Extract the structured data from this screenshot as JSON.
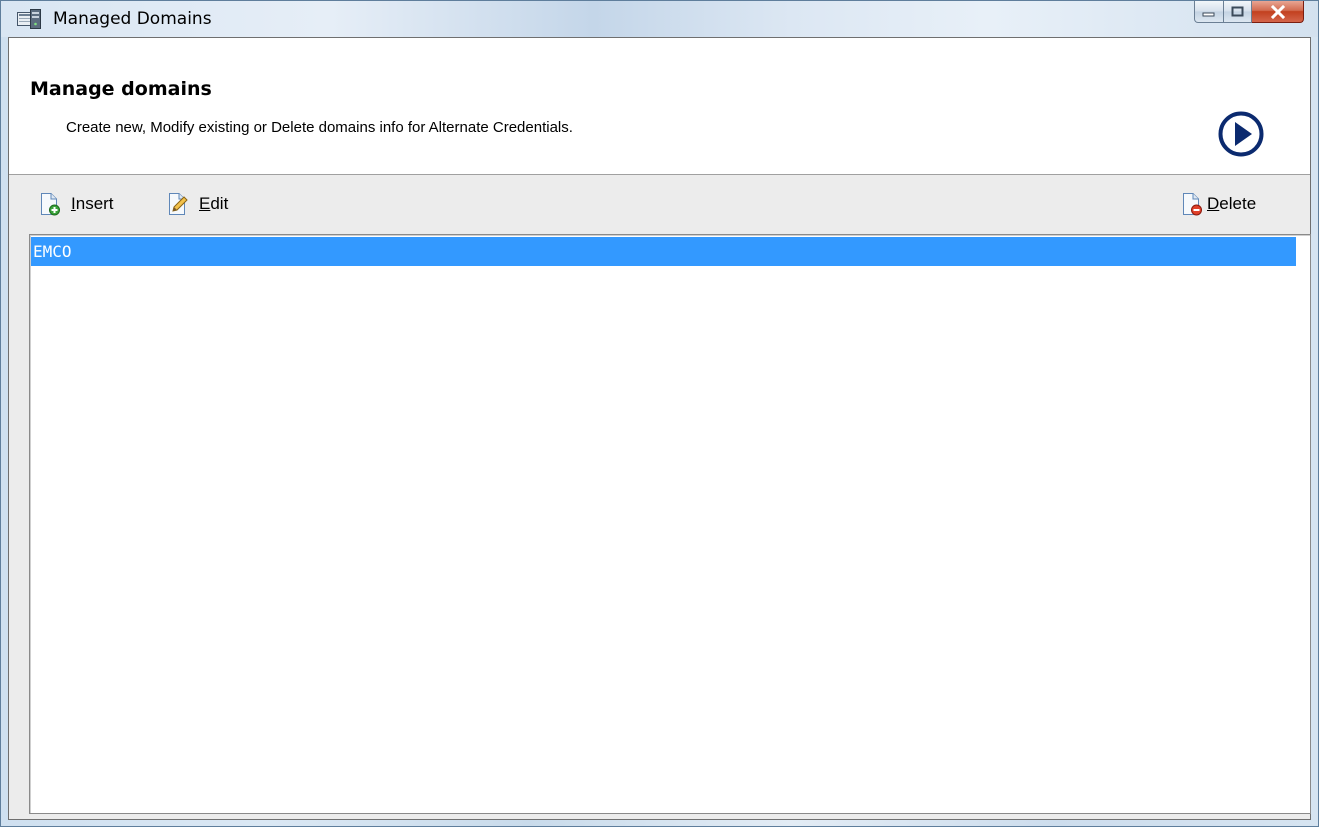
{
  "window": {
    "title": "Managed Domains",
    "icons": {
      "app": "domains-app-icon",
      "minimize": "minimize-icon",
      "maximize": "maximize-icon",
      "close": "close-icon"
    }
  },
  "header": {
    "title": "Manage domains",
    "description": "Create new, Modify existing or Delete domains info for Alternate Credentials.",
    "icon": "play-arrow-icon"
  },
  "toolbar": {
    "insert": {
      "accel": "I",
      "rest": "nsert",
      "icon": "insert-document-icon"
    },
    "edit": {
      "accel": "E",
      "rest": "dit",
      "icon": "edit-document-icon"
    },
    "delete": {
      "accel": "D",
      "rest": "elete",
      "icon": "delete-document-icon"
    }
  },
  "domains": {
    "items": [
      "EMCO"
    ],
    "selected_index": 0
  },
  "colors": {
    "selection": "#3399ff",
    "accent": "#0b2a6f"
  }
}
